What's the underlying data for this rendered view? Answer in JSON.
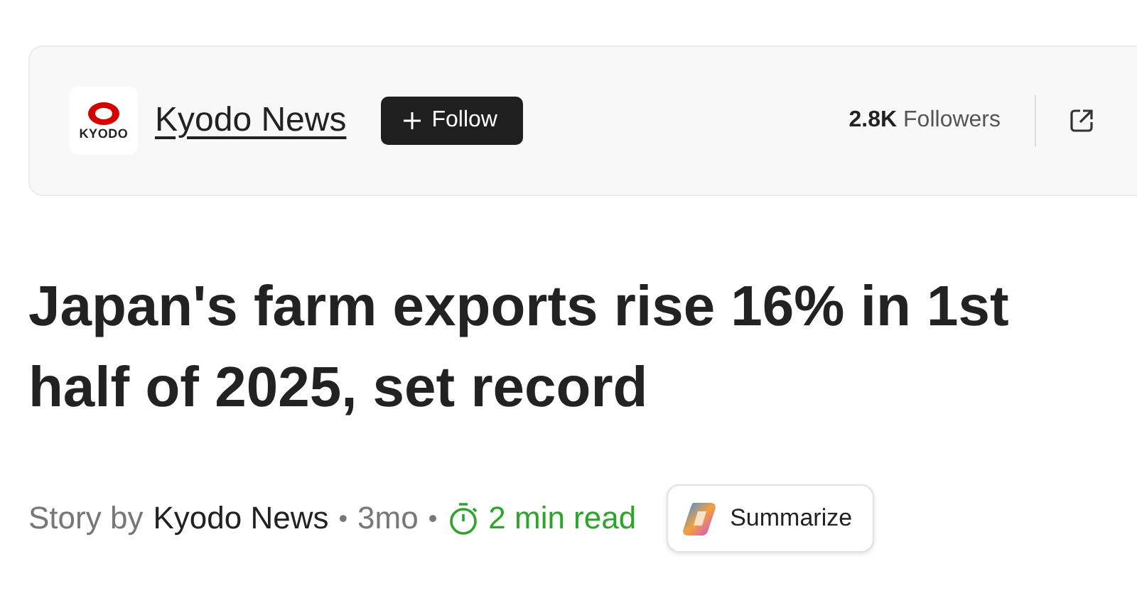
{
  "publisher": {
    "logo_text": "KYODO",
    "name": "Kyodo News",
    "follow_button": "Follow",
    "followers_count": "2.8K",
    "followers_label": "Followers"
  },
  "headline": "Japan's farm exports rise 16% in 1st half of 2025, set record",
  "byline": {
    "prefix": "Story by",
    "author": "Kyodo News",
    "separators": [
      "•",
      "•"
    ],
    "age": "3mo",
    "read_time": "2 min read",
    "summarize_button": "Summarize"
  }
}
